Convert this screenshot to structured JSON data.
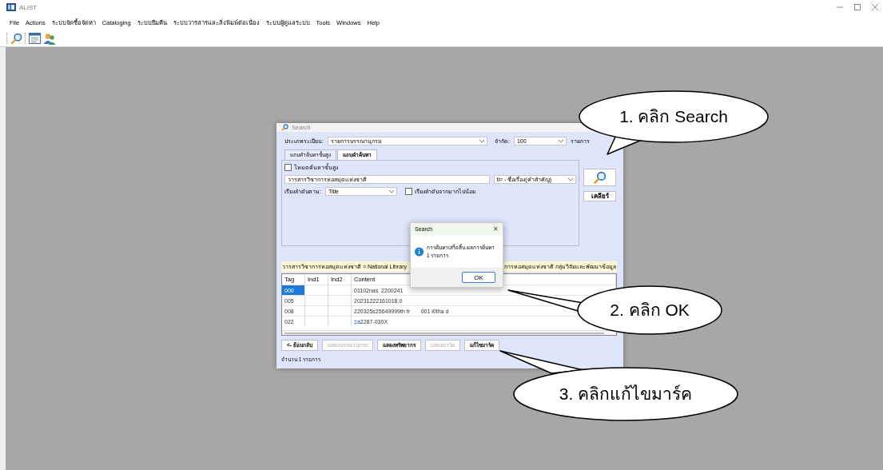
{
  "app": {
    "title": "ALIST"
  },
  "menu": [
    "File",
    "Actions",
    "ระบบจัดซื้อจัดหา",
    "Cataloging",
    "ระบบยืมคืน",
    "ระบบวารสารและสิ่งพิมพ์ต่อเนื่อง",
    "ระบบผู้ดูแลระบบ",
    "Tools",
    "Windows",
    "Help"
  ],
  "search_window": {
    "title": "Search",
    "record_type": {
      "label": "ประเภทระเบียน:",
      "value": "รายการบรรณานุกรม"
    },
    "limit": {
      "label": "จำกัด:",
      "value": "100",
      "unit": "รายการ"
    },
    "tabs": [
      {
        "label": "แถบคำค้นหาขั้นสูง",
        "selected": false
      },
      {
        "label": "แถบคำค้นหา",
        "selected": true
      }
    ],
    "advanced_mode": {
      "label": "โหมดค้นหาขั้นสูง",
      "checked": false
    },
    "query": "วารสารวิชาการหอสมุดแห่งชาติ",
    "index": "ti= - ชื่อเรื่อง(คำสำคัญ)",
    "sort": {
      "label": "เรียงลำดับตาม:",
      "value": "Title"
    },
    "descending": {
      "label": "เรียงลำดับจากมากไปน้อย",
      "checked": false
    },
    "clear_button": "เคลียร์",
    "result_left": "วารสารวิชาการหอสมุดแห่งชาติ = National Library",
    "result_right": "การหอสมุดแห่งชาติ กลุ่มวิจัยและพัฒนาข้อมูล",
    "table": {
      "columns": [
        "Tag",
        "Ind1",
        "Ind2",
        "Content"
      ],
      "rows": [
        {
          "tag": "000",
          "content": "01102nas  2200241",
          "selected": true
        },
        {
          "tag": "005",
          "content": "20231222161018.0",
          "selected": false
        },
        {
          "tag": "008",
          "content": "220325s25649999th fr       001 i0tha d",
          "selected": false
        },
        {
          "tag": "022",
          "subfield": "‡a",
          "content": "2287-030X",
          "selected": false
        }
      ]
    },
    "buttons": [
      {
        "label": "<- ย้อนกลับ",
        "disabled": false
      },
      {
        "label": "แสดงบรรณานุกรม",
        "disabled": true
      },
      {
        "label": "แสดงทรัพยากร",
        "disabled": false
      },
      {
        "label": "แสดงมาร์ค",
        "disabled": true
      },
      {
        "label": "แก้ไขมาร์ค",
        "disabled": false
      }
    ],
    "status": "จำนวน 1 รายการ"
  },
  "message_box": {
    "title": "Search",
    "close": "✕",
    "message": "การค้นหาเสร็จสิ้น ผลการค้นหา 1 รายการ",
    "button": "OK"
  },
  "callouts": [
    "1. คลิก Search",
    "2. คลิก OK",
    "3. คลิกแก้ไขมาร์ค"
  ]
}
